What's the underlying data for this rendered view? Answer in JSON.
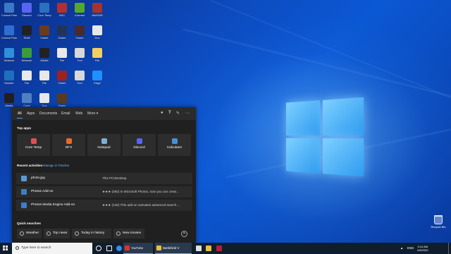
{
  "desktop": {
    "icons": [
      {
        "label": "Control Panel",
        "color": "#3c78c8"
      },
      {
        "label": "Discord",
        "color": "#5865f2"
      },
      {
        "label": "Core Temp",
        "color": "#2a6fc0"
      },
      {
        "label": "VNC",
        "color": "#b03030"
      },
      {
        "label": "uTorrent",
        "color": "#55a82a"
      },
      {
        "label": "WinRAR",
        "color": "#a8322f"
      },
      {
        "label": "Control Panel",
        "color": "#2f6ed0"
      },
      {
        "label": "Shell",
        "color": "#222222"
      },
      {
        "label": "Game",
        "color": "#6b3b1a"
      },
      {
        "label": "Game",
        "color": "#223355"
      },
      {
        "label": "Game",
        "color": "#4a2a2a"
      },
      {
        "label": "Doc",
        "color": "#e8e8e8"
      },
      {
        "label": "Network",
        "color": "#2f8fd8"
      },
      {
        "label": "Network",
        "color": "#3a9d3a"
      },
      {
        "label": "Media",
        "color": "#222222"
      },
      {
        "label": "File",
        "color": "#e8e8e8"
      },
      {
        "label": "Tool",
        "color": "#d8d8d8"
      },
      {
        "label": "File",
        "color": "#f0d060"
      },
      {
        "label": "Monitor",
        "color": "#1f6fc0"
      },
      {
        "label": "File",
        "color": "#e8e8e8"
      },
      {
        "label": "File",
        "color": "#e8e8e8"
      },
      {
        "label": "Game",
        "color": "#a02020"
      },
      {
        "label": "Tool",
        "color": "#d8d8d8"
      },
      {
        "label": "Edge",
        "color": "#1e90ff"
      },
      {
        "label": "Media",
        "color": "#202020"
      },
      {
        "label": "Cube",
        "color": "#5080c0"
      },
      {
        "label": "Doc",
        "color": "#e8e8e8"
      },
      {
        "label": "Game",
        "color": "#5a3a1a"
      }
    ],
    "recycle_bin_label": "Recycle Bin"
  },
  "search_panel": {
    "tabs": [
      "All",
      "Apps",
      "Documents",
      "Email",
      "Web",
      "More"
    ],
    "active_tab": "All",
    "more_arrow": "▾",
    "top_apps_title": "Top apps",
    "top_apps": [
      {
        "name": "Core Temp",
        "icon": "core-temp-icon",
        "color": "#e05050"
      },
      {
        "name": "DFX",
        "icon": "dfx-icon",
        "color": "#e86a2a"
      },
      {
        "name": "Notepad",
        "icon": "notepad-icon",
        "color": "#7ab0d8"
      },
      {
        "name": "Discord",
        "icon": "discord-icon",
        "color": "#5865f2"
      },
      {
        "name": "Calculator",
        "icon": "calculator-icon",
        "color": "#4a8fd8"
      }
    ],
    "recent_title": "Recent activities",
    "recent_manage": "Manage in Timeline",
    "recent": [
      {
        "name": "photo.jpg",
        "detail": "This PC\\Desktop",
        "color": "#5a9ad8"
      },
      {
        "name": "Photos Add-on",
        "detail": "★★★ (492) In Microsoft Photos, now you can creat...",
        "color": "#3a7fc8"
      },
      {
        "name": "Photos Media Engine Add-on",
        "detail": "★★★ (128) This add-on activates advanced search ...",
        "color": "#3a7fc8"
      }
    ],
    "quick_title": "Quick searches",
    "quick": [
      {
        "label": "Weather"
      },
      {
        "label": "Top news"
      },
      {
        "label": "Today in history"
      },
      {
        "label": "New movies"
      }
    ],
    "quick_close": "✕"
  },
  "taskbar": {
    "search_placeholder": "Type here to search",
    "items": [
      {
        "label": "YouTube",
        "color": "#e03030"
      },
      {
        "label": "Battlefield V",
        "color": "#e8c040"
      }
    ],
    "tray_text": "ENG",
    "time": "3:14 AM",
    "date": "2/8/2020"
  }
}
